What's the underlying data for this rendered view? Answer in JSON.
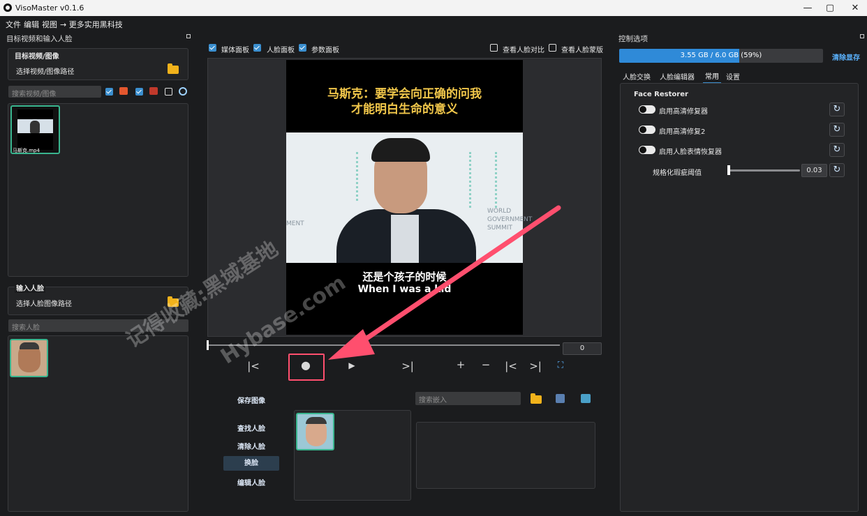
{
  "window": {
    "title": "VisoMaster v0.1.6",
    "min": "—",
    "max": "▢",
    "close": "✕"
  },
  "menu": [
    "文件",
    "编辑",
    "视图",
    "→ 更多实用黑科技"
  ],
  "left": {
    "header": "目标视频和输入人脸",
    "target_group": {
      "title": "目标视频/图像",
      "path_label": "选择视频/图像路径"
    },
    "search_media_placeholder": "搜索视频/图像",
    "media_file": "马斯克.mp4",
    "input_group": {
      "title": "输入人脸",
      "path_label": "选择人脸图像路径"
    },
    "search_face_placeholder": "搜索人脸"
  },
  "center": {
    "checks": [
      {
        "label": "媒体面板",
        "checked": true
      },
      {
        "label": "人脸面板",
        "checked": true
      },
      {
        "label": "参数面板",
        "checked": true
      }
    ],
    "right_checks": [
      {
        "label": "查看人脸对比",
        "checked": false
      },
      {
        "label": "查看人脸蒙版",
        "checked": false
      }
    ],
    "video": {
      "caption_top_1": "马斯克：要学会向正确的问我",
      "caption_top_2": "才能明白生命的意义",
      "sub_cn": "还是个孩子的时候",
      "sub_en": "When I was a kid",
      "bg_right_1": "WORLD",
      "bg_right_2": "GOVERNMENT",
      "bg_right_3": "SUMMIT",
      "bg_left": "MENT"
    },
    "frame_value": "0",
    "controls": {
      "prev": "|<",
      "record": "●",
      "play": "▶",
      "next": ">|",
      "plus": "+",
      "minus": "−",
      "start": "|<",
      "end": ">|",
      "fit": "⛶"
    },
    "save_image": "保存图像",
    "search_embed_placeholder": "搜索嵌入",
    "face_buttons": [
      "查找人脸",
      "清除人脸",
      "换脸",
      "编辑人脸"
    ]
  },
  "right": {
    "header": "控制选项",
    "memory": {
      "text": "3.55 GB / 6.0 GB (59%)",
      "fraction": 0.59,
      "clear": "清除显存"
    },
    "tabs": [
      "人脸交换",
      "人脸编辑器",
      "常用",
      "设置"
    ],
    "active_tab": "常用",
    "section": "Face Restorer",
    "toggles": [
      "启用高清修复器",
      "启用高清修复2",
      "启用人脸表情恢复器"
    ],
    "slider": {
      "label": "规格化瑕疵阈值",
      "value": "0.03",
      "fraction": 0.0
    }
  },
  "watermark": {
    "line1": "记得收藏:黑域基地",
    "line2": "Hybase.com"
  },
  "colors": {
    "accent": "#3b8fcf",
    "highlight": "#ff4f6e",
    "thumb_border": "#39b58e"
  }
}
